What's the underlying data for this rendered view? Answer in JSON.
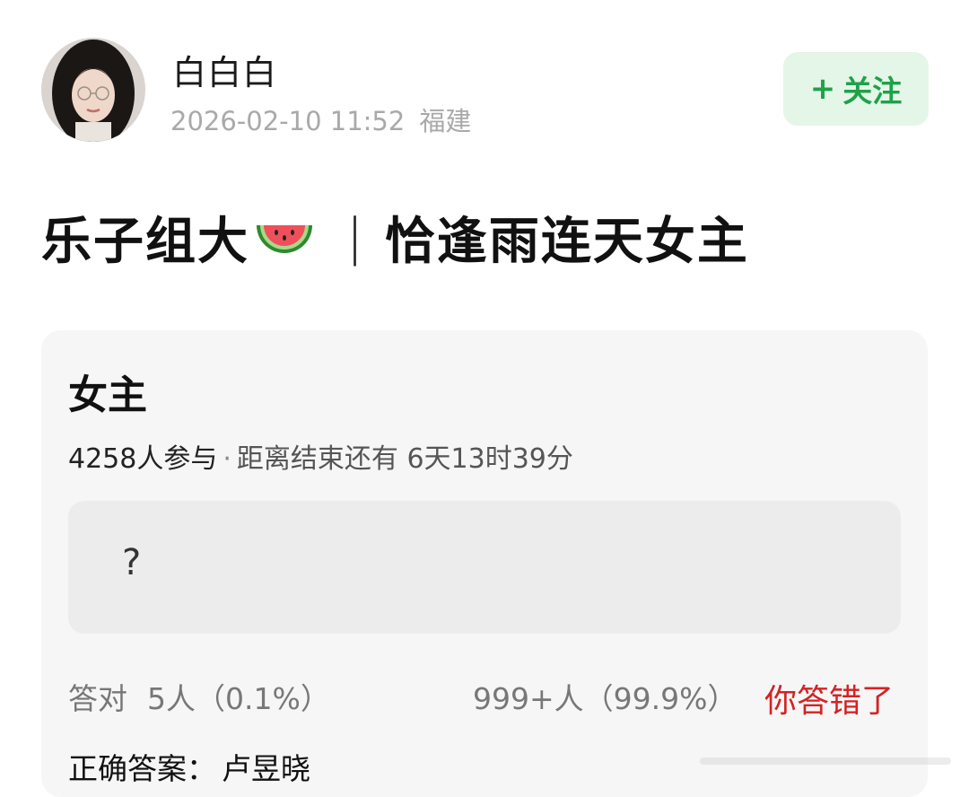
{
  "user": {
    "name": "白白白",
    "timestamp": "2026-02-10 11:52",
    "location": "福建"
  },
  "follow_button": {
    "plus": "+",
    "label": "关注"
  },
  "post": {
    "title_part1": "乐子组大",
    "title_emoji": "watermelon-emoji",
    "title_separator": "|",
    "title_part2": "恰逢雨连天女主"
  },
  "poll": {
    "title": "女主",
    "participants": "4258人参与",
    "dot": "·",
    "remaining": "距离结束还有 6天13时39分",
    "option_text": "?",
    "correct_label": "答对",
    "correct_count": "5人（0.1%）",
    "wrong_count": "999+人（99.9%）",
    "wrong_status": "你答错了",
    "answer_label": "正确答案：",
    "answer_value": "卢昱晓"
  },
  "colors": {
    "follow_bg": "#e4f6e8",
    "follow_text": "#1fa14a",
    "card_bg": "#f6f6f6",
    "option_bg": "#ececec",
    "wrong_text": "#d42323"
  }
}
